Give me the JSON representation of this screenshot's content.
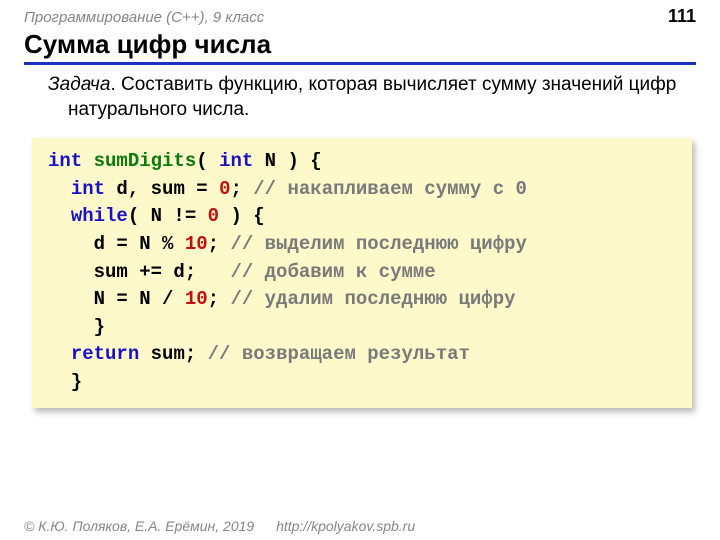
{
  "header": {
    "course": "Программирование (C++), 9 класс",
    "page": "111"
  },
  "title": "Сумма цифр числа",
  "task": {
    "label": "Задача",
    "text": ". Составить функцию, которая вычисляет сумму значений цифр натурального числа."
  },
  "code": {
    "kw_int1": "int",
    "fn_name": "sumDigits",
    "sig_open": "( ",
    "kw_int2": "int",
    "sig_rest": " N ) {",
    "l2_indent": "  ",
    "kw_int3": "int",
    "l2_rest1": " d, sum = ",
    "num0": "0",
    "l2_rest2": "; ",
    "cm_l2": "// накапливаем сумму с 0",
    "l3_indent": "  ",
    "kw_while": "while",
    "l3_cond1": "( N != ",
    "num0b": "0",
    "l3_cond2": " ) {",
    "l4": "    d = N % ",
    "num10a": "10",
    "l4b": "; ",
    "cm_l4": "// выделим последнюю цифру",
    "l5": "    sum += d;   ",
    "cm_l5": "// добавим к сумме",
    "l6": "    N = N / ",
    "num10b": "10",
    "l6b": "; ",
    "cm_l6": "// удалим последнюю цифру",
    "l7": "    }",
    "l8_indent": "  ",
    "kw_return": "return",
    "l8_rest": " sum; ",
    "cm_l8": "// возвращаем результат",
    "l9": "  }"
  },
  "footer": {
    "copyright": "© К.Ю. Поляков, Е.А. Ерёмин, 2019",
    "url": "http://kpolyakov.spb.ru"
  }
}
